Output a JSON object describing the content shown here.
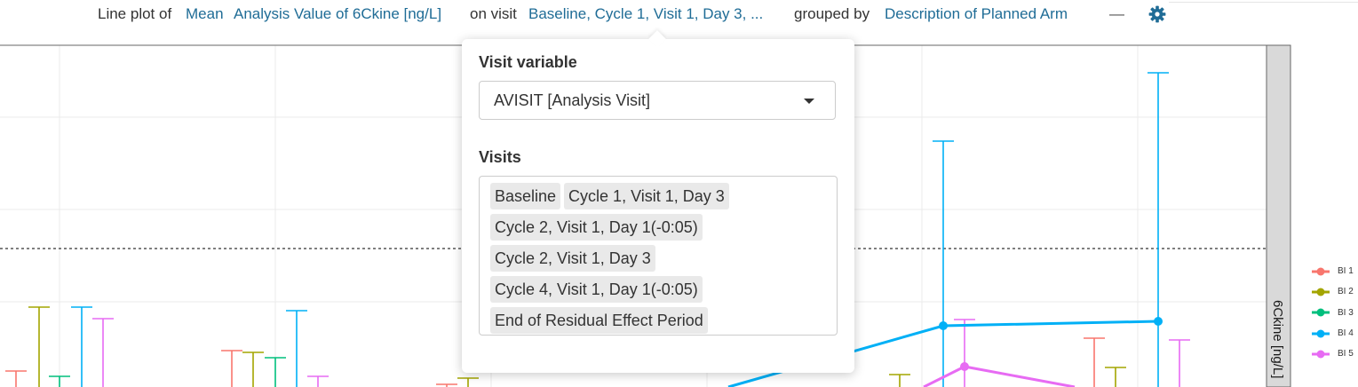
{
  "header": {
    "prefix": "Line plot of",
    "stat": "Mean",
    "variable": "Analysis Value of 6Ckine [ng/L]",
    "on_visit": "on visit",
    "visits_summary": "Baseline, Cycle 1, Visit 1, Day 3, ...",
    "grouped_by": "grouped by",
    "group_var": "Description of Planned Arm",
    "collapse_symbol": "—",
    "settings_icon": "gear-icon"
  },
  "popover": {
    "visit_variable_label": "Visit variable",
    "visit_variable_value": "AVISIT [Analysis Visit]",
    "visits_label": "Visits",
    "visits": [
      "Baseline",
      "Cycle 1, Visit 1, Day 3",
      "Cycle 2, Visit 1, Day 1(-0:05)",
      "Cycle 2, Visit 1, Day 3",
      "Cycle 4, Visit 1, Day 1(-0:05)",
      "End of Residual Effect Period"
    ]
  },
  "plot": {
    "facet_label": "6Ckine [ng/L]",
    "legend": [
      {
        "label": "BI 1",
        "color": "#F8766D"
      },
      {
        "label": "BI 2",
        "color": "#A3A500"
      },
      {
        "label": "BI 3",
        "color": "#00BF7D"
      },
      {
        "label": "BI 4",
        "color": "#00B0F6"
      },
      {
        "label": "BI 5",
        "color": "#E76BF3"
      }
    ]
  }
}
